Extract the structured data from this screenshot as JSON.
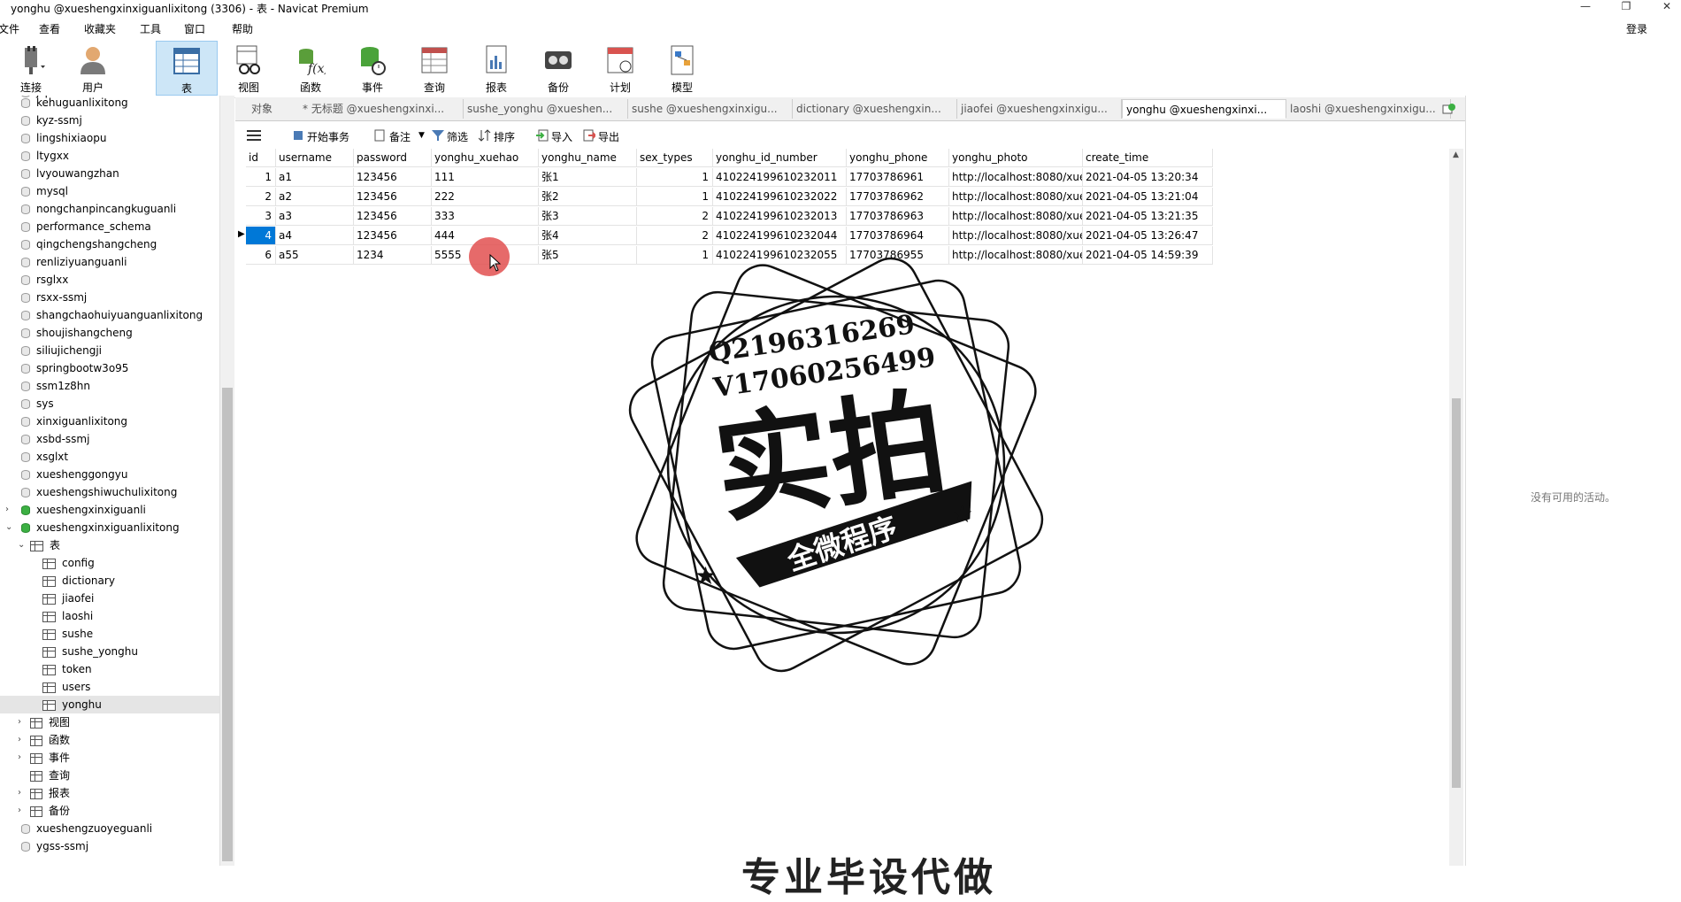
{
  "window": {
    "title": "yonghu @xueshengxinxiguanlixitong (3306) - 表 - Navicat Premium",
    "login": "登录"
  },
  "menu": [
    "文件",
    "查看",
    "收藏夹",
    "工具",
    "窗口",
    "帮助"
  ],
  "toolbar": {
    "items": [
      {
        "label": "连接",
        "icon": "plug-icon"
      },
      {
        "label": "用户",
        "icon": "user-icon"
      },
      {
        "label": "表",
        "icon": "table-icon"
      },
      {
        "label": "视图",
        "icon": "view-icon"
      },
      {
        "label": "函数",
        "icon": "function-icon"
      },
      {
        "label": "事件",
        "icon": "event-icon"
      },
      {
        "label": "查询",
        "icon": "query-icon"
      },
      {
        "label": "报表",
        "icon": "report-icon"
      },
      {
        "label": "备份",
        "icon": "backup-icon"
      },
      {
        "label": "计划",
        "icon": "schedule-icon"
      },
      {
        "label": "模型",
        "icon": "model-icon"
      }
    ]
  },
  "sidebar": {
    "databases_top": [
      "kehuguanlixitong",
      "kyz-ssmj",
      "lingshixiaopu",
      "ltygxx",
      "lvyouwangzhan",
      "mysql",
      "nongchanpincangkuguanli",
      "performance_schema",
      "qingchengshangcheng",
      "renliziyuanguanli",
      "rsglxx",
      "rsxx-ssmj",
      "shangchaohuiyuanguanlixitong",
      "shoujishangcheng",
      "siliujichengji",
      "springbootw3o95",
      "ssm1z8hn",
      "sys",
      "xinxiguanlixitong",
      "xsbd-ssmj",
      "xsglxt",
      "xueshenggongyu",
      "xueshengshiwuchulixitong"
    ],
    "db_closed_green": "xueshengxinxiguanli",
    "db_open": "xueshengxinxiguanlixitong",
    "tables_label": "表",
    "tables": [
      "config",
      "dictionary",
      "jiaofei",
      "laoshi",
      "sushe",
      "sushe_yonghu",
      "token",
      "users",
      "yonghu"
    ],
    "groups": [
      "视图",
      "函数",
      "事件",
      "查询",
      "报表",
      "备份"
    ],
    "databases_bottom": [
      "xueshengzuoyeguanli",
      "ygss-ssmj"
    ]
  },
  "tabs": [
    {
      "label": "对象"
    },
    {
      "label": "* 无标题 @xueshengxinxi..."
    },
    {
      "label": "sushe_yonghu @xueshen..."
    },
    {
      "label": "sushe @xueshengxinxigu..."
    },
    {
      "label": "dictionary @xueshengxin..."
    },
    {
      "label": "jiaofei @xueshengxinxigu..."
    },
    {
      "label": "yonghu @xueshengxinxi..."
    },
    {
      "label": "laoshi @xueshengxinxigu..."
    }
  ],
  "object_toolbar": {
    "begin_tx": "开始事务",
    "memo": "备注",
    "filter": "筛选",
    "sort": "排序",
    "import": "导入",
    "export": "导出"
  },
  "table": {
    "columns": [
      "id",
      "username",
      "password",
      "yonghu_xuehao",
      "yonghu_name",
      "sex_types",
      "yonghu_id_number",
      "yonghu_phone",
      "yonghu_photo",
      "create_time"
    ],
    "rows": [
      [
        "1",
        "a1",
        "123456",
        "111",
        "张1",
        "1",
        "410224199610232011",
        "17703786961",
        "http://localhost:8080/xues",
        "2021-04-05 13:20:34"
      ],
      [
        "2",
        "a2",
        "123456",
        "222",
        "张2",
        "1",
        "410224199610232022",
        "17703786962",
        "http://localhost:8080/xues",
        "2021-04-05 13:21:04"
      ],
      [
        "3",
        "a3",
        "123456",
        "333",
        "张3",
        "2",
        "410224199610232013",
        "17703786963",
        "http://localhost:8080/xues",
        "2021-04-05 13:21:35"
      ],
      [
        "4",
        "a4",
        "123456",
        "444",
        "张4",
        "2",
        "410224199610232044",
        "17703786964",
        "http://localhost:8080/xues",
        "2021-04-05 13:26:47"
      ],
      [
        "6",
        "a55",
        "1234",
        "5555",
        "张5",
        "1",
        "410224199610232055",
        "17703786955",
        "http://localhost:8080/xues",
        "2021-04-05 14:59:39"
      ]
    ],
    "selected_row": 3
  },
  "right_panel": {
    "empty_text": "没有可用的活动。"
  },
  "watermark": {
    "line1": "Q2196316269",
    "line2": "V17060256499",
    "big": "实拍",
    "ribbon": "全微程序",
    "bottom": "专业毕设代做"
  }
}
